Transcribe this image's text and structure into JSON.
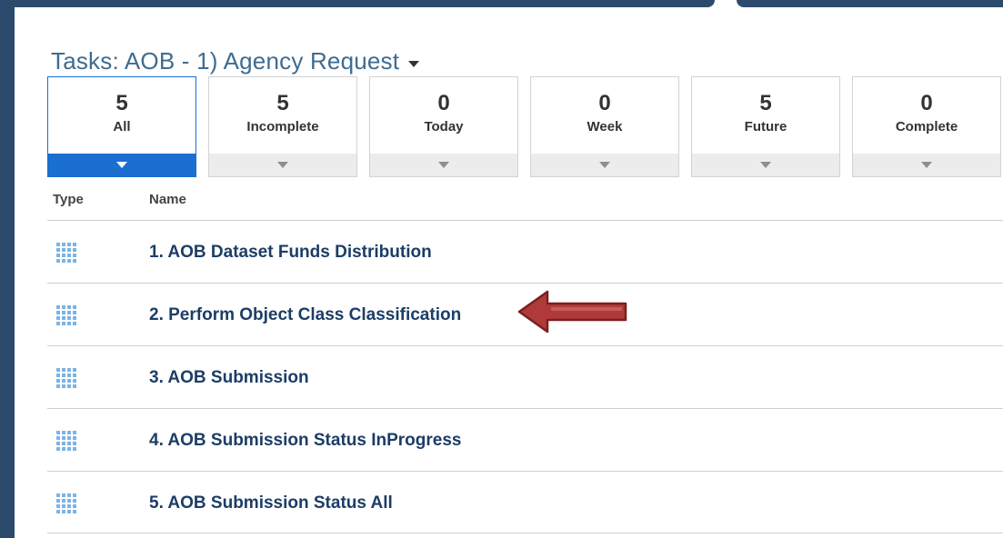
{
  "header": {
    "title": "Tasks: AOB - 1) Agency Request"
  },
  "tiles": [
    {
      "count": "5",
      "label": "All",
      "selected": true
    },
    {
      "count": "5",
      "label": "Incomplete",
      "selected": false
    },
    {
      "count": "0",
      "label": "Today",
      "selected": false
    },
    {
      "count": "0",
      "label": "Week",
      "selected": false
    },
    {
      "count": "5",
      "label": "Future",
      "selected": false
    },
    {
      "count": "0",
      "label": "Complete",
      "selected": false
    }
  ],
  "table": {
    "columns": [
      "Type",
      "Name"
    ],
    "rows": [
      {
        "type_icon": "grid-icon",
        "name": "1. AOB Dataset Funds Distribution"
      },
      {
        "type_icon": "grid-icon",
        "name": "2. Perform Object Class Classification"
      },
      {
        "type_icon": "grid-icon",
        "name": "3. AOB Submission"
      },
      {
        "type_icon": "grid-icon",
        "name": "4. AOB Submission Status InProgress"
      },
      {
        "type_icon": "grid-icon",
        "name": "5. AOB Submission Status All"
      }
    ]
  },
  "annotation": {
    "icon": "left-arrow-icon",
    "color": "#b03a3a"
  },
  "colors": {
    "frame": "#2c4a6b",
    "title": "#3e6c91",
    "accent": "#1a6fd1",
    "task_text": "#1c3d66",
    "task_icon": "#7ab4e6"
  }
}
